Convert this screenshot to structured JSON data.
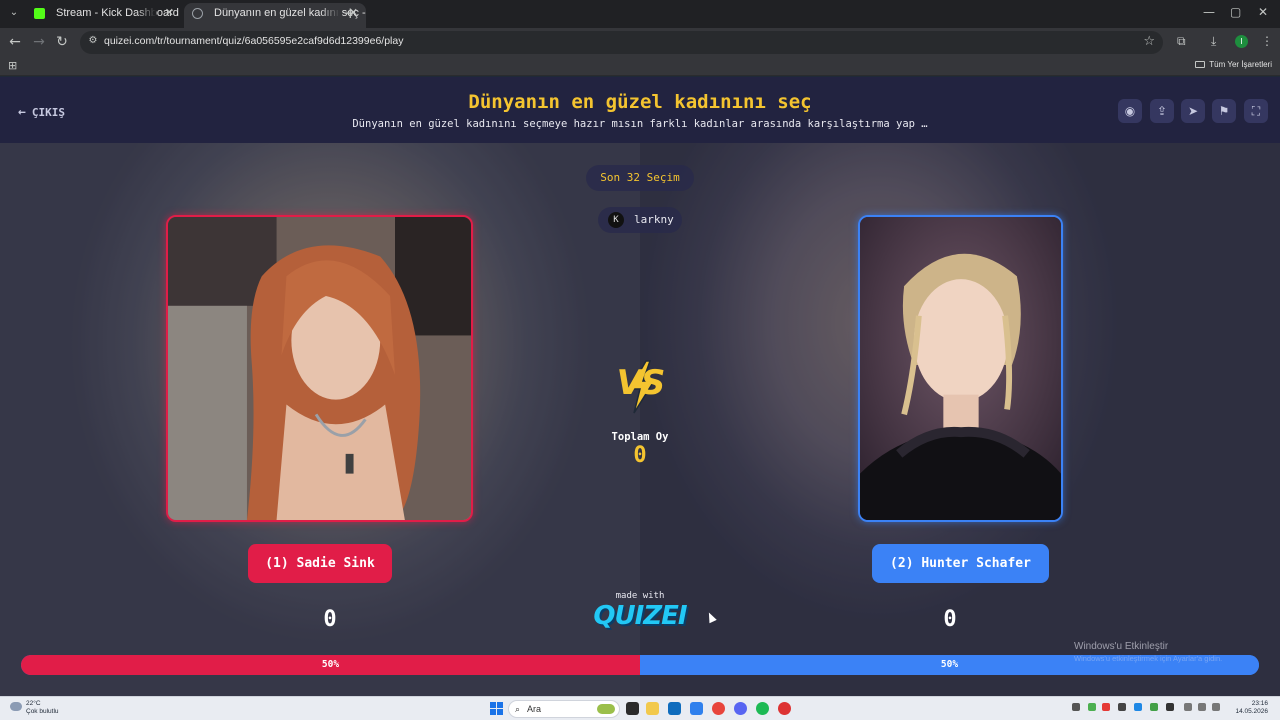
{
  "browser": {
    "tabs": [
      {
        "title": "Stream - Kick Dashboard",
        "active": false
      },
      {
        "title": "Dünyanın en güzel kadını seç - ⠀",
        "active": true
      }
    ],
    "new_tab_label": "+",
    "url": "quizei.com/tr/tournament/quiz/6a056595e2caf9d6d12399e6/play",
    "profile_initial": "I",
    "all_bookmarks_label": "Tüm Yer İşaretleri",
    "controls": {
      "minimize": "—",
      "maximize": "▢",
      "close": "✕"
    }
  },
  "page": {
    "exit_label": "ÇIKIŞ",
    "title": "Dünyanın en güzel kadınını seç",
    "subtitle": "Dünyanın en güzel kadınını seçmeye hazır mısın farklı kadınlar arasında karşılaştırma yap …",
    "header_icons": [
      "eye-icon",
      "share-icon",
      "send-icon",
      "flag-icon",
      "fullscreen-icon"
    ],
    "round_label": "Son 32 Seçim",
    "streamer_name": "larkny",
    "vs_text": "VS",
    "total_votes_label": "Toplam Oy",
    "total_votes_value": "0",
    "left": {
      "name": "(1) Sadie Sink",
      "score": "0",
      "percent_label": "50%",
      "percent": 50,
      "color": "#e11d48"
    },
    "right": {
      "name": "(2) Hunter Schafer",
      "score": "0",
      "percent_label": "50%",
      "percent": 50,
      "color": "#3b82f6"
    },
    "made_with_label": "made with",
    "brand": "QUIZEI",
    "accent_color": "#f4c430"
  },
  "windows": {
    "activate_title": "Windows'u Etkinleştir",
    "activate_sub": "Windows'u etkinleştirmek için Ayarlar'a gidin.",
    "weather_temp": "22°C",
    "weather_desc": "Çok bulutlu",
    "search_label": "Ara",
    "time": "23:16",
    "date": "14.05.2026"
  }
}
